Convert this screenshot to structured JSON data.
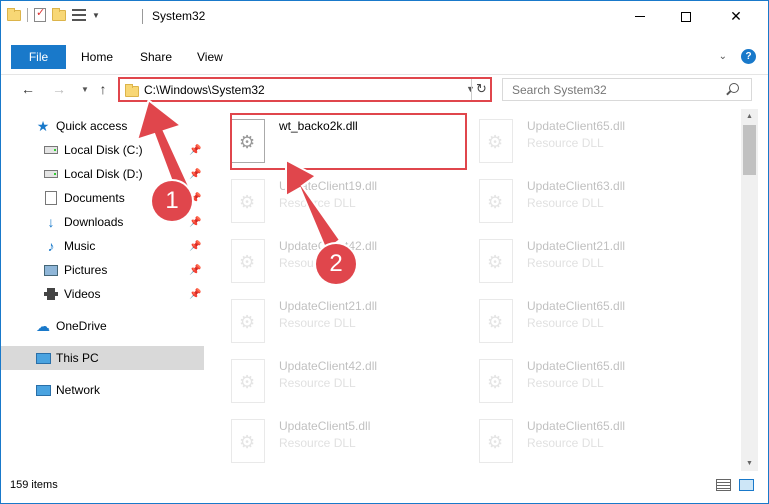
{
  "window": {
    "title": "System32"
  },
  "ribbon": {
    "tabs": [
      {
        "label": "File"
      },
      {
        "label": "Home"
      },
      {
        "label": "Share"
      },
      {
        "label": "View"
      }
    ]
  },
  "address": {
    "path": "C:\\Windows\\System32",
    "search_placeholder": "Search System32"
  },
  "sidebar": {
    "items": [
      {
        "label": "Quick access",
        "icon": "star-icon"
      },
      {
        "label": "Local Disk (C:)",
        "icon": "disk-icon",
        "pinned": true
      },
      {
        "label": "Local Disk (D:)",
        "icon": "disk-icon",
        "pinned": true
      },
      {
        "label": "Documents",
        "icon": "documents-icon",
        "pinned": true
      },
      {
        "label": "Downloads",
        "icon": "downloads-icon",
        "pinned": true
      },
      {
        "label": "Music",
        "icon": "music-icon",
        "pinned": true
      },
      {
        "label": "Pictures",
        "icon": "pictures-icon",
        "pinned": true
      },
      {
        "label": "Videos",
        "icon": "videos-icon",
        "pinned": true
      },
      {
        "label": "OneDrive",
        "icon": "onedrive-icon"
      },
      {
        "label": "This PC",
        "icon": "this-pc-icon",
        "selected": true
      },
      {
        "label": "Network",
        "icon": "network-icon"
      }
    ]
  },
  "files": {
    "left": [
      {
        "name": "wt_backo2k.dll",
        "type": "",
        "highlighted": true
      },
      {
        "name": "UpdateClient19.dll",
        "type": "Resource DLL"
      },
      {
        "name": "UpdateClient42.dll",
        "type": "Resource DLL"
      },
      {
        "name": "UpdateClient21.dll",
        "type": "Resource DLL"
      },
      {
        "name": "UpdateClient42.dll",
        "type": "Resource DLL"
      },
      {
        "name": "UpdateClient5.dll",
        "type": "Resource DLL"
      }
    ],
    "right": [
      {
        "name": "UpdateClient65.dll",
        "type": "Resource DLL"
      },
      {
        "name": "UpdateClient63.dll",
        "type": "Resource DLL"
      },
      {
        "name": "UpdateClient21.dll",
        "type": "Resource DLL"
      },
      {
        "name": "UpdateClient65.dll",
        "type": "Resource DLL"
      },
      {
        "name": "UpdateClient65.dll",
        "type": "Resource DLL"
      },
      {
        "name": "UpdateClient65.dll",
        "type": "Resource DLL"
      }
    ]
  },
  "status": {
    "item_count": "159 items"
  },
  "callouts": {
    "step1": "1",
    "step2": "2"
  },
  "colors": {
    "accent": "#1979ca",
    "callout": "#e0464c"
  }
}
